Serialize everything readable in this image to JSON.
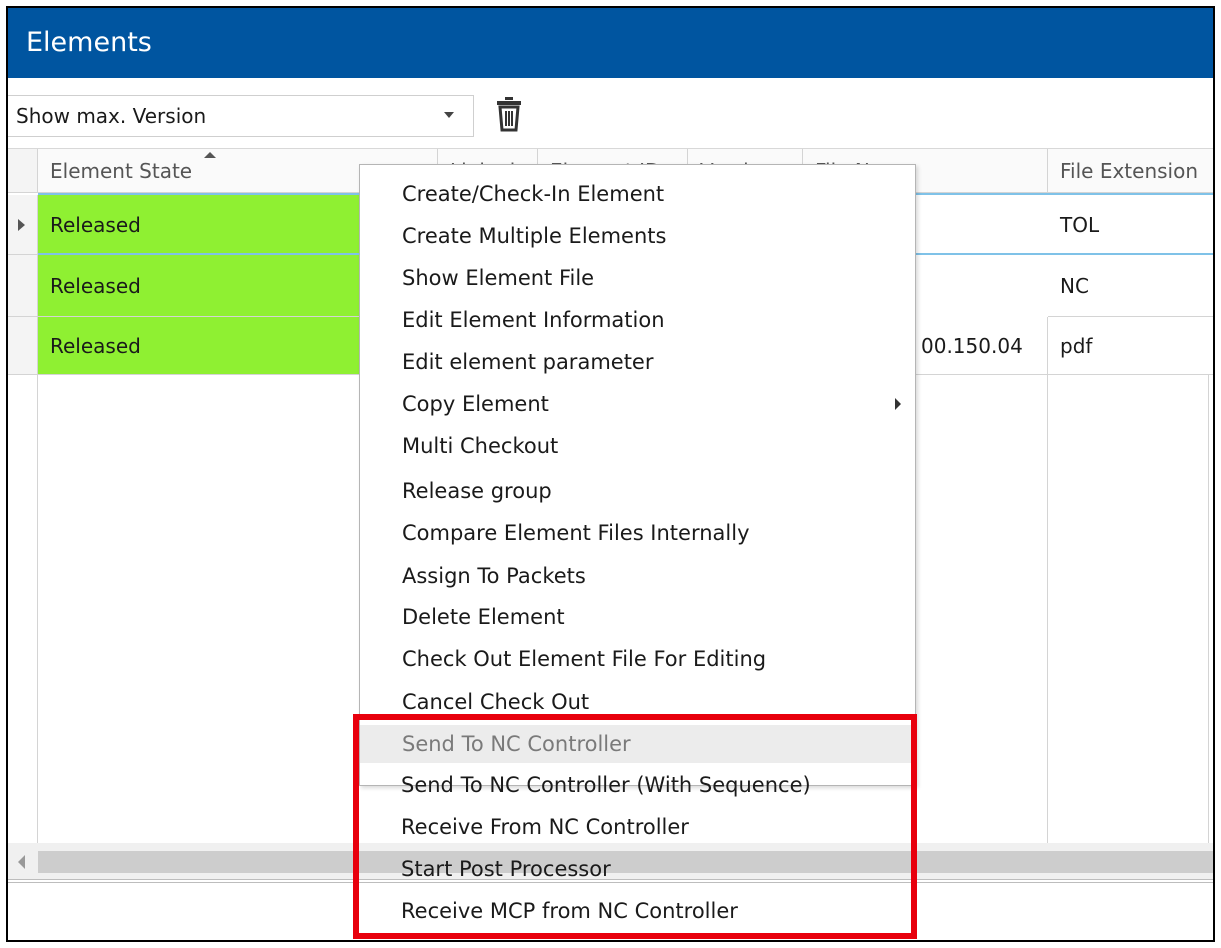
{
  "window": {
    "title": "Elements"
  },
  "toolbar": {
    "version_filter": "Show max. Version"
  },
  "grid": {
    "columns": [
      "Element State",
      "Linked",
      "Element ID",
      "Version",
      "File Name",
      "File Extension"
    ],
    "rows": [
      {
        "state": "Released",
        "file_name": "",
        "file_ext": "TOL"
      },
      {
        "state": "Released",
        "file_name": "",
        "file_ext": "NC"
      },
      {
        "state": "Released",
        "file_name": "00.150.04",
        "file_ext": "pdf"
      }
    ]
  },
  "context_menu": {
    "items": [
      "Create/Check-In Element",
      "Create Multiple Elements",
      "Show Element File",
      "Edit Element Information",
      "Edit element parameter",
      "Copy Element",
      "Multi Checkout",
      "Release group",
      "Compare Element Files Internally",
      "Assign To Packets",
      "Delete Element",
      "Check Out Element File For Editing",
      "Cancel Check Out",
      "Send To NC Controller",
      "Send To NC Controller (With Sequence)",
      "Receive From NC Controller",
      "Start Post Processor",
      "Receive MCP from NC Controller"
    ]
  },
  "colors": {
    "titlebar": "#0055a0",
    "released": "#8ff032",
    "highlight": "#e8000d"
  }
}
